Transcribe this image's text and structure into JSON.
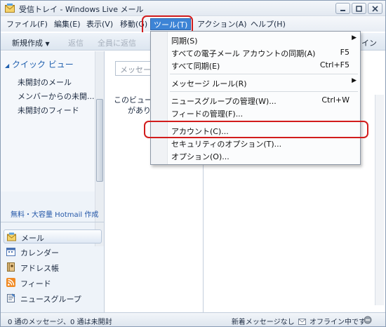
{
  "window": {
    "title": "受信トレイ - Windows Live メール"
  },
  "menubar": {
    "items": [
      "ファイル(F)",
      "編集(E)",
      "表示(V)",
      "移動(G)",
      "ツール(T)",
      "アクション(A)",
      "ヘルプ(H)"
    ],
    "active": "ツール(T)"
  },
  "toolbar": {
    "new": "新規作成",
    "reply": "返信",
    "reply_all": "全員に返信",
    "online": "イン"
  },
  "quick_view": {
    "header": "クイック ビュー",
    "items": [
      "未開封のメール",
      "メンバーからの未開...",
      "未開封のフィード"
    ]
  },
  "hotmail_link": "無料・大容量 Hotmail 作成",
  "nav": {
    "items": [
      "メール",
      "カレンダー",
      "アドレス帳",
      "フィード",
      "ニュースグループ"
    ],
    "selected": "メール"
  },
  "search": {
    "placeholder": "メッセージ"
  },
  "empty_view": {
    "line1": "このビュー",
    "line2": "があり"
  },
  "tools_menu": {
    "items": [
      {
        "label": "同期(S)",
        "shortcut": "",
        "submenu": true
      },
      {
        "label": "すべての電子メール アカウントの同期(A)",
        "shortcut": "F5",
        "submenu": false
      },
      {
        "label": "すべて同期(E)",
        "shortcut": "Ctrl+F5",
        "submenu": false
      },
      {
        "label": "メッセージ ルール(R)",
        "shortcut": "",
        "submenu": true
      },
      {
        "label": "ニュースグループの管理(W)...",
        "shortcut": "Ctrl+W",
        "submenu": false
      },
      {
        "label": "フィードの管理(F)...",
        "shortcut": "",
        "submenu": false
      },
      {
        "label": "アカウント(C)...",
        "shortcut": "",
        "submenu": false
      },
      {
        "label": "セキュリティのオプション(T)...",
        "shortcut": "",
        "submenu": false
      },
      {
        "label": "オプション(O)...",
        "shortcut": "",
        "submenu": false
      }
    ]
  },
  "status": {
    "left": "0 通のメッセージ、0 通は未開封",
    "right": "新着メッセージなし",
    "offline": "オフライン中です"
  },
  "colors": {
    "menu_highlight": "#3d84d6",
    "annotation_red": "#d21c1c",
    "link_blue": "#2457a8"
  }
}
